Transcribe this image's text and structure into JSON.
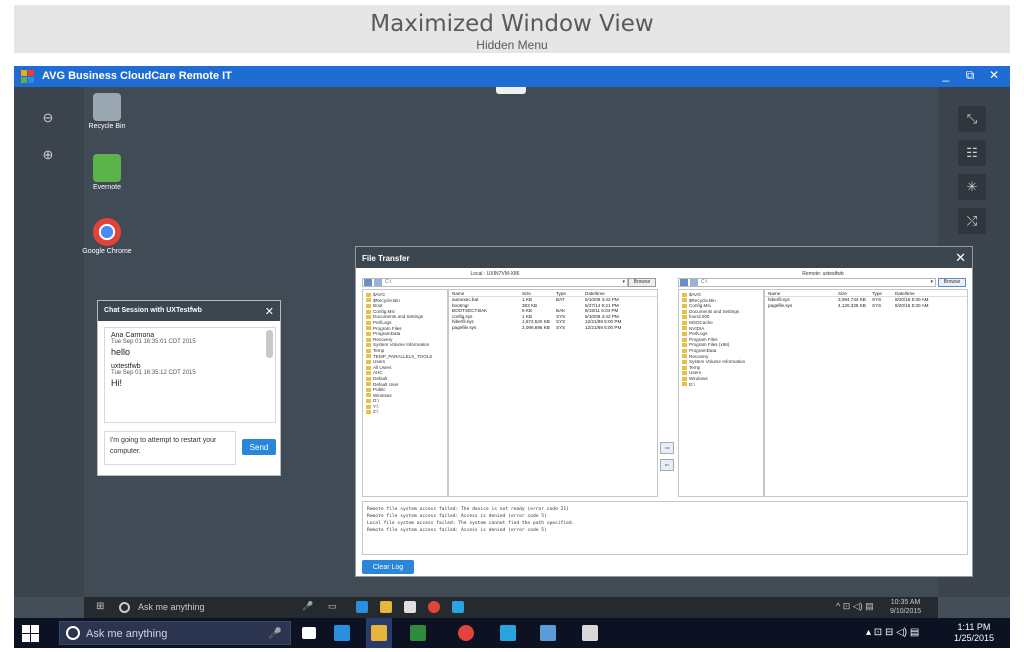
{
  "banner": {
    "title": "Maximized Window View",
    "subtitle": "Hidden Menu"
  },
  "app": {
    "title": "AVG Business CloudCare Remote IT",
    "window_controls": {
      "minimize": "_",
      "restore": "⧉",
      "close": "✕"
    }
  },
  "left_tools": {
    "zoom_out": "⊖",
    "zoom_in": "⊕"
  },
  "right_tools": {
    "fit": "⤡",
    "network": "☷",
    "loading": "✳",
    "unpin": "⤭"
  },
  "desktop_icons": [
    {
      "label": "Recycle Bin",
      "color": "#9aa6b0"
    },
    {
      "label": "Evernote",
      "color": "#5bb34a"
    },
    {
      "label": "Google Chrome",
      "color": "#e2443b"
    }
  ],
  "chat": {
    "title": "Chat Session with UXTestfwb",
    "close": "✕",
    "messages": [
      {
        "sender": "Ana Carmona",
        "timestamp": "Tue Sep 01 16:35:01 CDT 2015",
        "text": "hello"
      },
      {
        "sender": "uxtestfwb",
        "timestamp": "Tue Sep 01 16:35:12 CDT 2015",
        "text": "Hi!"
      }
    ],
    "input_value": "I'm going to attempt to restart your computer.",
    "send_label": "Send"
  },
  "file_transfer": {
    "title": "File Transfer",
    "close": "✕",
    "local": {
      "title": "Local : UXIN7VM-X86",
      "path": "C:\\",
      "browse_label": "Browse",
      "tree": [
        "$AVG",
        "$Recycle.Bin",
        "Boot",
        "Config.Msi",
        "Documents and Settings",
        "PerfLogs",
        "Program Files",
        "ProgramData",
        "Recovery",
        "System Volume Information",
        "Temp",
        "TEMP_PARALLELS_TOOLS",
        "Users",
        "All Users",
        "AHC",
        "Default",
        "Default User",
        "Public",
        "Windows",
        "D:\\",
        "Y:\\",
        "Z:\\"
      ],
      "columns": [
        "Name",
        "Size",
        "Type",
        "Date/time"
      ],
      "files": [
        [
          "autoexec.bat",
          "1 KB",
          "BAT",
          "6/10/09 4:42 PM"
        ],
        [
          "bootmgr",
          "383 KB",
          "",
          "6/27/14 5:21 PM"
        ],
        [
          "BOOTSECT.BAK",
          "8 KB",
          "BAK",
          "8/19/11 5:04 PM"
        ],
        [
          "config.sys",
          "1 KB",
          "SYS",
          "6/10/09 4:42 PM"
        ],
        [
          "hiberfil.sys",
          "1,572,520 KB",
          "SYS",
          "12/21/89 5:00 PM"
        ],
        [
          "pagefile.sys",
          "2,096,896 KB",
          "SYS",
          "12/21/89 5:00 PM"
        ]
      ]
    },
    "remote": {
      "title": "Remote: uxtestfwb",
      "path": "C:\\",
      "browse_label": "Browse",
      "tree": [
        "$AVG",
        "$Recycle.Bin",
        "Config.Msi",
        "Documents and Settings",
        "found.000",
        "MSOCache",
        "NVIDIA",
        "PerfLogs",
        "Program Files",
        "Program Files (x86)",
        "ProgramData",
        "Recovery",
        "System Volume Information",
        "Temp",
        "Users",
        "Windows",
        "D:\\"
      ],
      "columns": [
        "Name",
        "Size",
        "Type",
        "Date/time"
      ],
      "files": [
        [
          "hiberfil.sys",
          "3,094,744 KB",
          "SYS",
          "8/20/15 5:30 AM"
        ],
        [
          "pagefile.sys",
          "4,126,328 KB",
          "SYS",
          "8/20/15 5:30 AM"
        ]
      ]
    },
    "transfer_right": "⇒",
    "transfer_left": "⇐",
    "log": [
      "Remote file system access failed: The device is not ready (error code 21)",
      "Remote file system access failed: Access is denied (error code 5)",
      "Local file system access failed: The system cannot find the path specified.",
      "Remote file system access failed: Access is denied (error code 5)"
    ],
    "clear_log_label": "Clear Log"
  },
  "inner_taskbar": {
    "search_text": "Ask me anything",
    "time": "10:35 AM",
    "date": "9/10/2015"
  },
  "taskbar": {
    "search_text": "Ask me anything",
    "time": "1:11 PM",
    "date": "1/25/2015"
  }
}
